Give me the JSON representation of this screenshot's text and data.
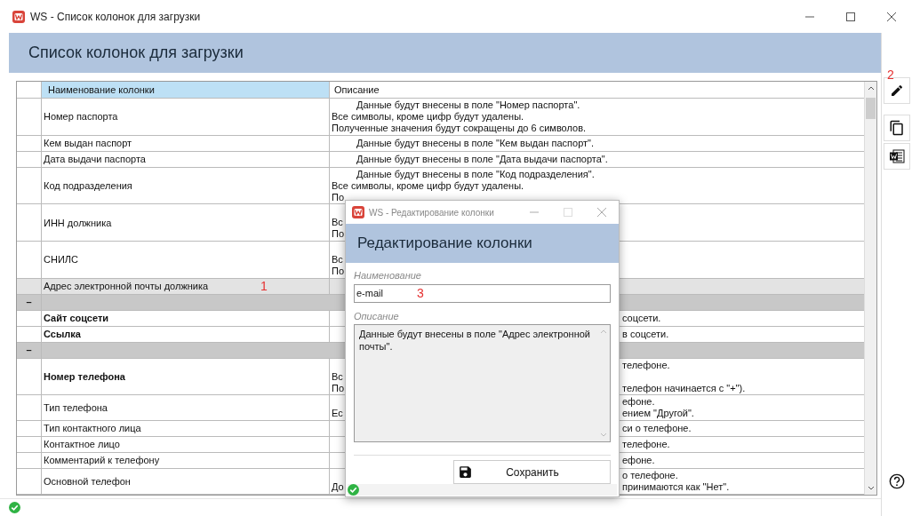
{
  "window": {
    "title": "WS - Список колонок для загрузки"
  },
  "header": "Список колонок для загрузки",
  "table": {
    "columns": [
      "Наименование колонки",
      "Описание"
    ],
    "rows": [
      {
        "kind": "item",
        "name": "Номер паспорта",
        "bold": false,
        "selected": false,
        "lines": [
          {
            "kind": "indented",
            "text": "Данные будут внесены в поле \"Номер паспорта\"."
          },
          {
            "kind": "full",
            "text": "Все символы, кроме цифр будут удалены."
          },
          {
            "kind": "full",
            "text": "Полученные значения будут сокращены до 6 символов."
          }
        ]
      },
      {
        "kind": "item",
        "name": "Кем выдан паспорт",
        "bold": false,
        "selected": false,
        "lines": [
          {
            "kind": "indented",
            "text": "Данные будут внесены в поле \"Кем выдан паспорт\"."
          }
        ]
      },
      {
        "kind": "item",
        "name": "Дата выдачи паспорта",
        "bold": false,
        "selected": false,
        "lines": [
          {
            "kind": "indented",
            "text": "Данные будут внесены в поле \"Дата выдачи паспорта\"."
          }
        ]
      },
      {
        "kind": "item",
        "name": "Код подразделения",
        "bold": false,
        "selected": false,
        "lines": [
          {
            "kind": "indented",
            "text": "Данные будут внесены в поле \"Код подразделения\"."
          },
          {
            "kind": "full",
            "text": "Все символы, кроме цифр будут удалены."
          },
          {
            "kind": "split",
            "left": "По"
          }
        ]
      },
      {
        "kind": "item",
        "name": "ИНН должника",
        "bold": false,
        "selected": false,
        "lines": [
          {
            "kind": "covered"
          },
          {
            "kind": "split",
            "left": "Вс"
          },
          {
            "kind": "split",
            "left": "По"
          }
        ]
      },
      {
        "kind": "item",
        "name": "СНИЛС",
        "bold": false,
        "selected": false,
        "lines": [
          {
            "kind": "covered"
          },
          {
            "kind": "split",
            "left": "Вс"
          },
          {
            "kind": "split",
            "left": "По"
          }
        ]
      },
      {
        "kind": "item",
        "name": "Адрес электронной почты должника",
        "bold": false,
        "selected": true,
        "annotation": "1",
        "lines": [
          {
            "kind": "covered"
          }
        ]
      },
      {
        "kind": "group",
        "toggle": "–",
        "selected": false
      },
      {
        "kind": "item",
        "name": "Сайт соцсети",
        "bold": true,
        "selected": false,
        "lines": [
          {
            "kind": "split",
            "right": "соцсети."
          }
        ]
      },
      {
        "kind": "item",
        "name": "Ссылка",
        "bold": true,
        "selected": false,
        "lines": [
          {
            "kind": "split",
            "right": "в соцсети."
          }
        ]
      },
      {
        "kind": "group",
        "toggle": "–",
        "selected": false
      },
      {
        "kind": "item",
        "name": "Номер телефона",
        "bold": true,
        "selected": false,
        "lines": [
          {
            "kind": "split",
            "right": "телефоне."
          },
          {
            "kind": "split",
            "left": "Вс"
          },
          {
            "kind": "split",
            "left": "По",
            "right": "телефон начинается с \"+\")."
          }
        ]
      },
      {
        "kind": "item",
        "name": "Тип телефона",
        "bold": false,
        "selected": false,
        "lines": [
          {
            "kind": "split",
            "right": "ефоне."
          },
          {
            "kind": "split",
            "left": "Ес",
            "right": "ением \"Другой\"."
          }
        ]
      },
      {
        "kind": "item",
        "name": "Тип контактного лица",
        "bold": false,
        "selected": false,
        "lines": [
          {
            "kind": "split",
            "right": "си о телефоне."
          }
        ]
      },
      {
        "kind": "item",
        "name": "Контактное лицо",
        "bold": false,
        "selected": false,
        "lines": [
          {
            "kind": "split",
            "right": "телефоне."
          }
        ]
      },
      {
        "kind": "item",
        "name": "Комментарий к телефону",
        "bold": false,
        "selected": false,
        "lines": [
          {
            "kind": "split",
            "right": "ефоне."
          }
        ]
      },
      {
        "kind": "item",
        "name": "Основной телефон",
        "bold": false,
        "selected": false,
        "lines": [
          {
            "kind": "split",
            "right": "о телефоне."
          },
          {
            "kind": "split",
            "left": "До",
            "right": "принимаются как \"Нет\"."
          }
        ]
      }
    ]
  },
  "toolbar": {
    "edit_annotation": "2"
  },
  "dialog": {
    "title": "WS - Редактирование колонки",
    "header": "Редактирование колонки",
    "name_label": "Наименование",
    "name_value": "e-mail",
    "name_annotation": "3",
    "description_label": "Описание",
    "description_value": "Данные будут внесены в поле \"Адрес электронной почты\".",
    "save_button": "Сохранить"
  }
}
